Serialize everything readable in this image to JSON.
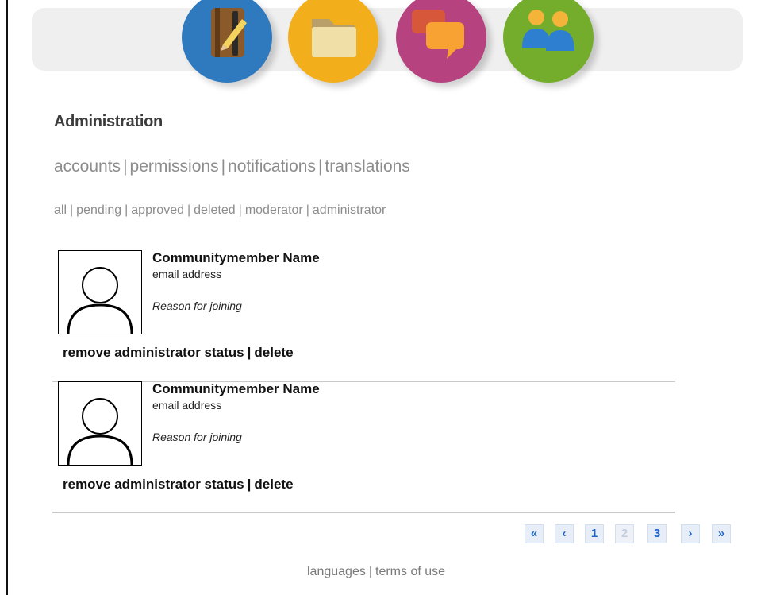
{
  "nav": {
    "icons": [
      "notebook-icon",
      "folder-icon",
      "chat-icon",
      "people-icon"
    ],
    "colors": {
      "notebook": "#2f79bf",
      "folder": "#f2ae1b",
      "chat": "#b6437f",
      "people": "#74ad2c"
    }
  },
  "page": {
    "title": "Administration"
  },
  "tabs": [
    "accounts",
    "permissions",
    "notifications",
    "translations"
  ],
  "filters": [
    "all",
    "pending",
    "approved",
    "deleted",
    "moderator",
    "administrator"
  ],
  "separator": "|",
  "members": [
    {
      "name": "Communitymember Name",
      "email": "email address",
      "reason": "Reason for joining",
      "action_remove": "remove administrator status",
      "action_delete": "delete"
    },
    {
      "name": "Communitymember Name",
      "email": "email address",
      "reason": "Reason for joining",
      "action_remove": "remove administrator status",
      "action_delete": "delete"
    }
  ],
  "pagination": {
    "first": "«",
    "prev": "‹",
    "pages": [
      "1",
      "2",
      "3"
    ],
    "current_page": "2",
    "next": "›",
    "last": "»"
  },
  "footer": {
    "languages": "languages",
    "terms": "terms of use"
  }
}
